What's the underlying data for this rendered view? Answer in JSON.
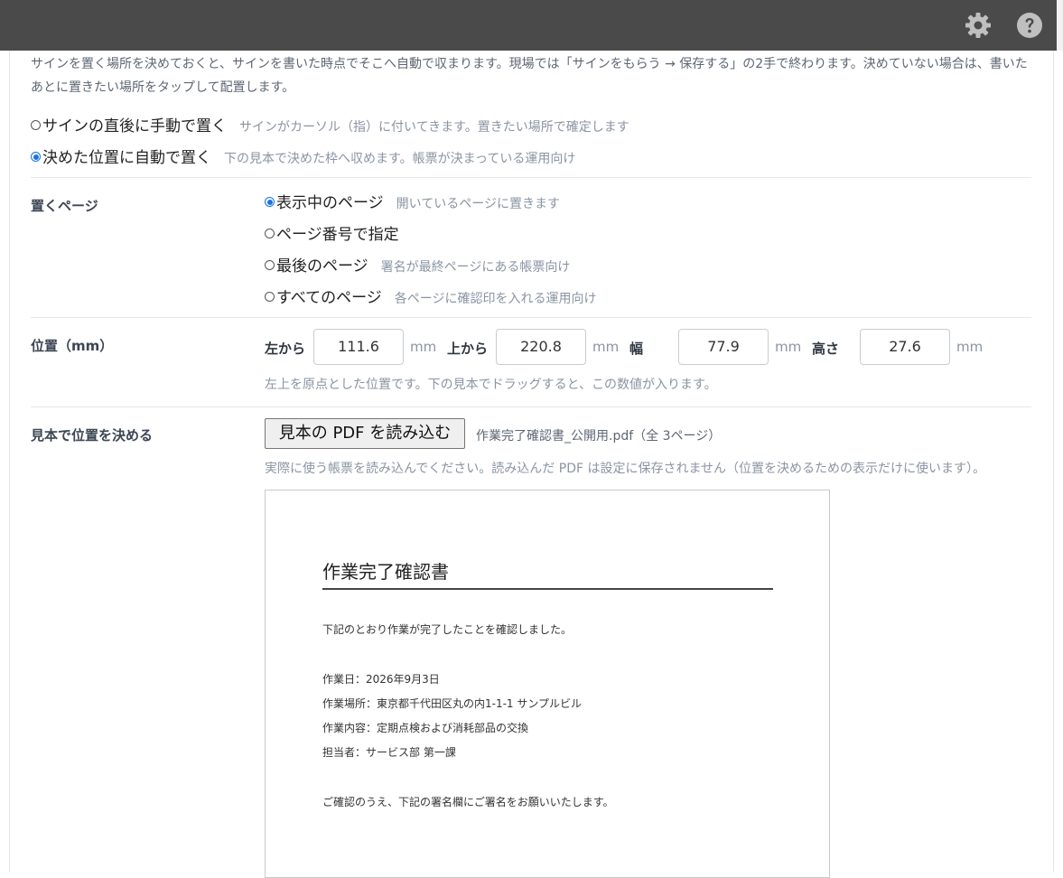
{
  "header": {
    "settings_icon": "gear-icon",
    "help_icon": "question-circle-icon",
    "bar_color": "#4a4a4a"
  },
  "intro_text": "サインを置く場所を決めておくと、サインを書いた時点でそこへ自動で収まります。現場では「サインをもらう → 保存する」の2手で終わります。決めていない場合は、書いたあとに置きたい場所をタップして配置します。",
  "placement_mode": {
    "selected": "auto",
    "options": [
      {
        "label": "サインの直後に手動で置く",
        "hint": "サインがカーソル（指）に付いてきます。置きたい場所で確定します"
      },
      {
        "label": "決めた位置に自動で置く",
        "hint": "下の見本で決めた枠へ収めます。帳票が決まっている運用向け"
      }
    ]
  },
  "page_setting": {
    "label": "置くページ",
    "selected_index": 0,
    "options": [
      {
        "label": "表示中のページ",
        "hint": "開いているページに置きます"
      },
      {
        "label": "ページ番号で指定",
        "hint": ""
      },
      {
        "label": "最後のページ",
        "hint": "署名が最終ページにある帳票向け"
      },
      {
        "label": "すべてのページ",
        "hint": "各ページに確認印を入れる運用向け"
      }
    ]
  },
  "position": {
    "label": "位置（mm）",
    "left_label": "左から",
    "left_value": "111.6",
    "top_label": "上から",
    "top_value": "220.8",
    "width_label": "幅",
    "width_value": "77.9",
    "height_label": "高さ",
    "height_value": "27.6",
    "unit": "mm",
    "help": "左上を原点とした位置です。下の見本でドラッグすると、この数値が入ります。"
  },
  "sample": {
    "label": "見本で位置を決める",
    "button": "見本の PDF を読み込む",
    "filename": "作業完了確認書_公開用.pdf（全 3ページ）",
    "help": "実際に使う帳票を読み込んでください。読み込んだ PDF は設定に保存されません（位置を決めるための表示だけに使います）。"
  },
  "document": {
    "title": "作業完了確認書",
    "lines": [
      "下記のとおり作業が完了したことを確認しました。",
      "作業日：2026年9月3日",
      "作業場所：東京都千代田区丸の内1-1-1 サンプルビル",
      "作業内容：定期点検および消耗部品の交換",
      "担当者：サービス部 第一課",
      "ご確認のうえ、下記の署名欄にご署名をお願いいたします。"
    ]
  },
  "colors": {
    "accent": "#1a73e8",
    "hint": "#8a94a3"
  }
}
